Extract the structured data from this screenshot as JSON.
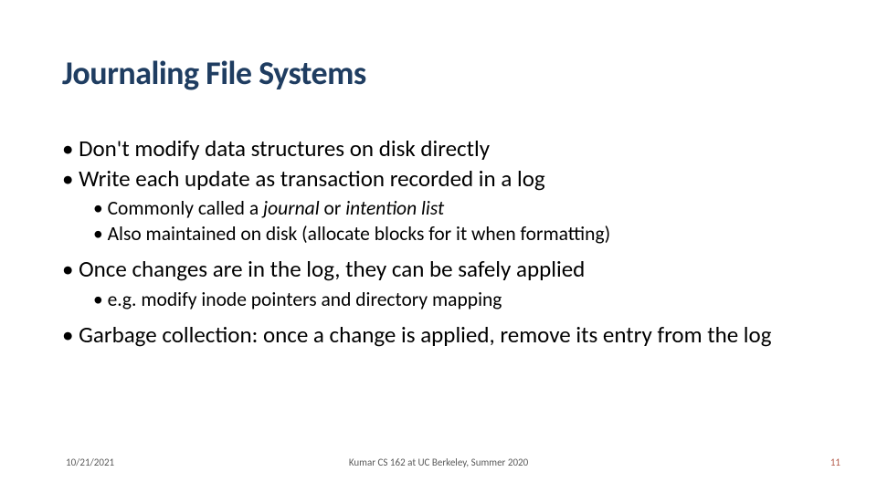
{
  "title": "Journaling File Systems",
  "bullets": {
    "b1": "Don't modify data structures on disk directly",
    "b2": "Write each update as transaction recorded in a log",
    "b2_sub1_pre": "Commonly called a ",
    "b2_sub1_j": "journal",
    "b2_sub1_mid": " or ",
    "b2_sub1_il": "intention list",
    "b2_sub2": "Also maintained on disk (allocate blocks for it when formatting)",
    "b3": "Once changes are in the log, they can be safely applied",
    "b3_sub1": "e.g. modify inode pointers and directory mapping",
    "b4": "Garbage collection: once a change is applied, remove its entry from the log"
  },
  "footer": {
    "date": "10/21/2021",
    "center": "Kumar CS 162 at UC Berkeley, Summer 2020",
    "num": "11"
  }
}
